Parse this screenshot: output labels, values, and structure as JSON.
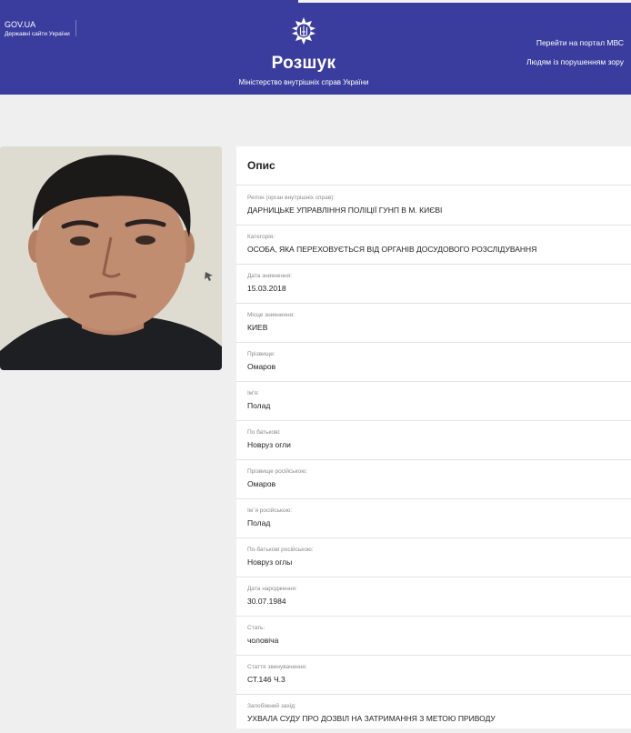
{
  "header": {
    "gov_title": "GOV.UA",
    "gov_subtitle": "Державні сайти України",
    "emblem_icon": "trident-emblem-icon",
    "title": "Розшук",
    "subtitle": "Міністерство внутрішніх справ України",
    "links": [
      "Перейти на портал МВС",
      "Людям із порушенням зору"
    ],
    "background": "#3a3d9d"
  },
  "photo": {
    "description_icon": "person-photo"
  },
  "card": {
    "title": "Опис",
    "fields": [
      {
        "label": "Регіон (орган внутрішніх справ):",
        "value": "ДАРНИЦЬКЕ УПРАВЛІННЯ ПОЛІЦІЇ ГУНП В М. КИЄВІ"
      },
      {
        "label": "Категорія:",
        "value": "ОСОБА, ЯКА ПЕРЕХОВУЄТЬСЯ ВІД ОРГАНІВ ДОСУДОВОГО РОЗСЛІДУВАННЯ"
      },
      {
        "label": "Дата зникнення:",
        "value": "15.03.2018"
      },
      {
        "label": "Місце зникнення:",
        "value": "КИЕВ"
      },
      {
        "label": "Прізвище:",
        "value": "Омаров"
      },
      {
        "label": "Ім'я:",
        "value": "Полад"
      },
      {
        "label": "По батькові:",
        "value": "Новруз огли"
      },
      {
        "label": "Прізвище російською:",
        "value": "Омаров"
      },
      {
        "label": "Ім`я російською:",
        "value": "Полад"
      },
      {
        "label": "По-батькові російською:",
        "value": "Новруз оглы"
      },
      {
        "label": "Дата народження:",
        "value": "30.07.1984"
      },
      {
        "label": "Стать:",
        "value": "чоловіча"
      },
      {
        "label": "Стаття звинувачення:",
        "value": "СТ.146 Ч.3"
      },
      {
        "label": "Запобіжний захід:",
        "value": "УХВАЛА СУДУ ПРО ДОЗВІЛ НА ЗАТРИМАННЯ З МЕТОЮ ПРИВОДУ"
      }
    ]
  }
}
